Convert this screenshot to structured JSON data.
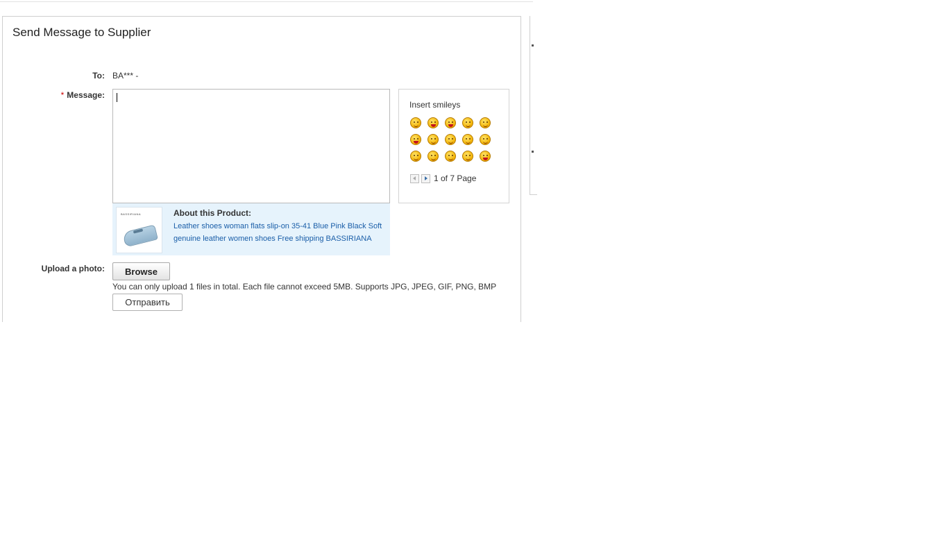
{
  "form": {
    "title": "Send Message to Supplier",
    "to_label": "To:",
    "to_value": "BA*** -",
    "required_mark": "*",
    "message_label": "Message:",
    "message_value": "",
    "upload_label": "Upload a photo:",
    "browse_label": "Browse",
    "upload_note": "You can only upload 1 files in total. Each file cannot exceed 5MB. Supports JPG, JPEG, GIF, PNG, BMP",
    "send_label": "Отправить"
  },
  "smileys": {
    "title": "Insert smileys",
    "icons": [
      "smile-icon",
      "wink-tongue-icon",
      "tongue-out-icon",
      "giggle-icon",
      "sleepy-icon",
      "laugh-icon",
      "big-grin-icon",
      "shy-smile-icon",
      "blush-icon",
      "squint-icon",
      "cheeky-icon",
      "grin-icon",
      "happy-icon",
      "surprised-icon",
      "kiss-icon"
    ],
    "pager_text": "1 of 7 Page"
  },
  "product": {
    "about_label": "About this Product:",
    "link_text": "Leather shoes woman flats slip-on 35-41 Blue Pink Black Soft genuine leather women shoes Free shipping BASSIRIANA",
    "thumb_brand": "BASSIRIANA"
  }
}
